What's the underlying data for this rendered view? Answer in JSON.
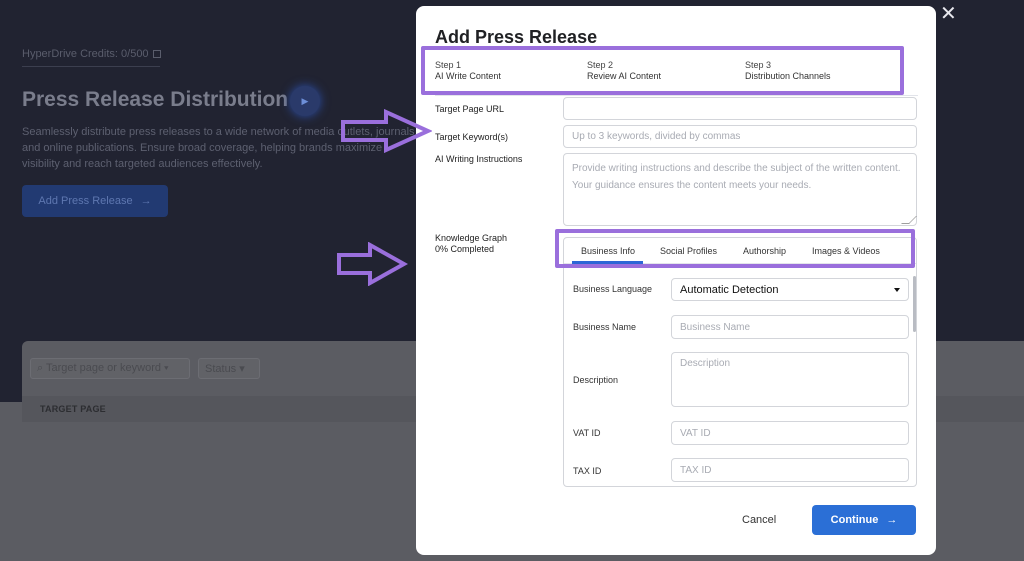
{
  "background": {
    "credits_text": "HyperDrive Credits: 0/500",
    "title": "Press Release Distribution",
    "description": "Seamlessly distribute press releases to a wide network of media outlets, journals and online publications. Ensure broad coverage, helping brands maximize visibility and reach targeted audiences effectively.",
    "add_button_label": "Add Press Release",
    "search_placeholder": "Target page or keyword",
    "status_label": "Status",
    "table_header": "TARGET PAGE"
  },
  "modal": {
    "title": "Add Press Release",
    "steps": [
      {
        "num": "Step 1",
        "label": "AI Write Content",
        "active": true
      },
      {
        "num": "Step 2",
        "label": "Review AI Content",
        "active": false
      },
      {
        "num": "Step 3",
        "label": "Distribution Channels",
        "active": false
      }
    ],
    "fields": {
      "target_url_label": "Target Page URL",
      "target_url_value": "",
      "keywords_label": "Target Keyword(s)",
      "keywords_placeholder": "Up to 3 keywords, divided by commas",
      "instructions_label": "AI Writing Instructions",
      "instructions_placeholder": "Provide writing instructions and describe the subject of the written content. Your guidance ensures the content meets your needs."
    },
    "knowledge_graph": {
      "label": "Knowledge Graph",
      "progress": "0% Completed",
      "tabs": [
        "Business Info",
        "Social Profiles",
        "Authorship",
        "Images & Videos"
      ],
      "active_tab": "Business Info",
      "business_language_label": "Business Language",
      "business_language_value": "Automatic Detection",
      "business_name_label": "Business Name",
      "business_name_placeholder": "Business Name",
      "description_label": "Description",
      "description_placeholder": "Description",
      "vat_label": "VAT ID",
      "vat_placeholder": "VAT ID",
      "tax_label": "TAX ID",
      "tax_placeholder": "TAX ID"
    },
    "cancel_label": "Cancel",
    "continue_label": "Continue"
  },
  "colors": {
    "accent": "#2b6fd6",
    "highlight": "#9a6fdc",
    "overlay": "#212331"
  }
}
